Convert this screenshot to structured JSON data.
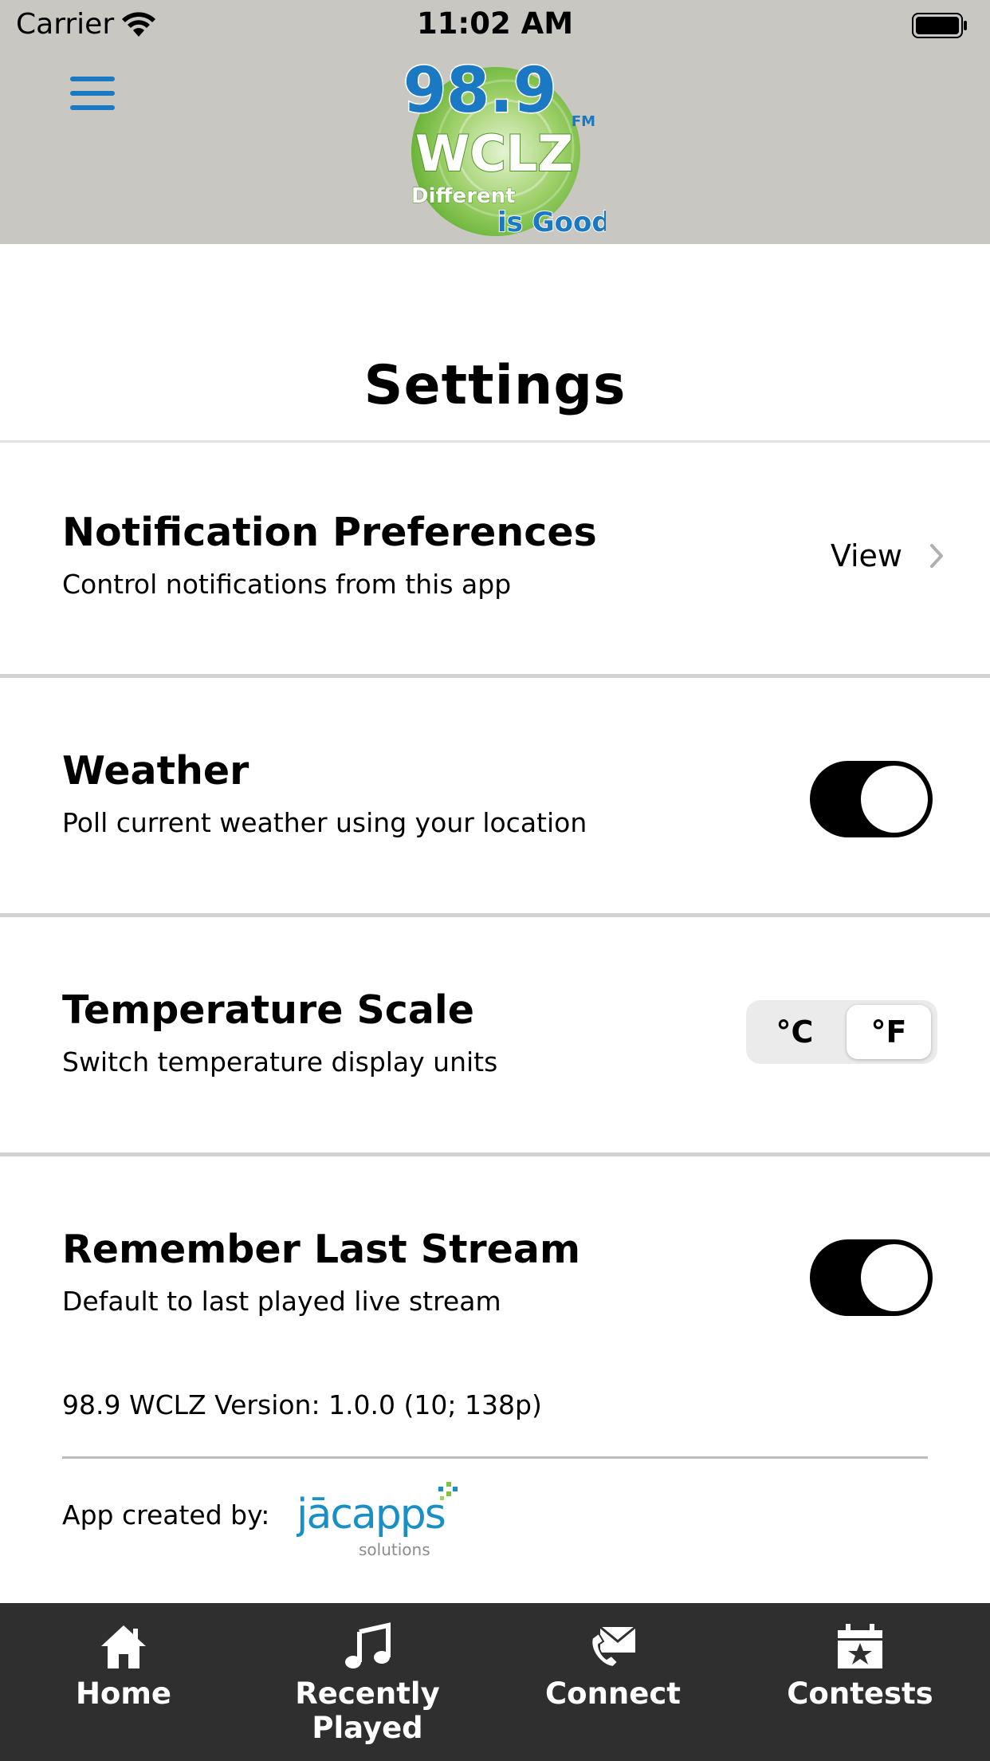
{
  "status_bar": {
    "carrier": "Carrier",
    "time": "11:02 AM"
  },
  "header": {
    "logo": {
      "frequency": "98.9",
      "band": "FM",
      "call_sign": "WCLZ",
      "tagline_1": "Different",
      "tagline_2": "is Good"
    },
    "menu_icon": "hamburger-menu-icon"
  },
  "page": {
    "title": "Settings"
  },
  "settings": [
    {
      "title": "Notification Preferences",
      "subtitle": "Control notifications from this app",
      "action_label": "View"
    },
    {
      "title": "Weather",
      "subtitle": "Poll current weather using your location",
      "toggle_on": true
    },
    {
      "title": "Temperature Scale",
      "subtitle": "Switch temperature display units",
      "options": [
        "°C",
        "°F"
      ],
      "selected": "°F"
    },
    {
      "title": "Remember Last Stream",
      "subtitle": "Default to last played live stream",
      "toggle_on": true
    }
  ],
  "footer": {
    "version": "98.9 WCLZ Version: 1.0.0 (10; 138p)",
    "created_by_label": "App created by:",
    "creator_logo_text": "jācapps",
    "creator_logo_sub": "solutions"
  },
  "tabs": [
    {
      "label": "Home",
      "icon": "home-icon"
    },
    {
      "label": "Recently Played",
      "icon": "music-note-icon"
    },
    {
      "label": "Connect",
      "icon": "envelope-phone-icon"
    },
    {
      "label": "Contests",
      "icon": "calendar-star-icon"
    }
  ],
  "colors": {
    "header_bg": "#c8c7c2",
    "accent_blue": "#1a79c2",
    "logo_green": "#7cc242",
    "tabbar_bg": "#2f2f2f",
    "toggle_on": "#000000"
  }
}
